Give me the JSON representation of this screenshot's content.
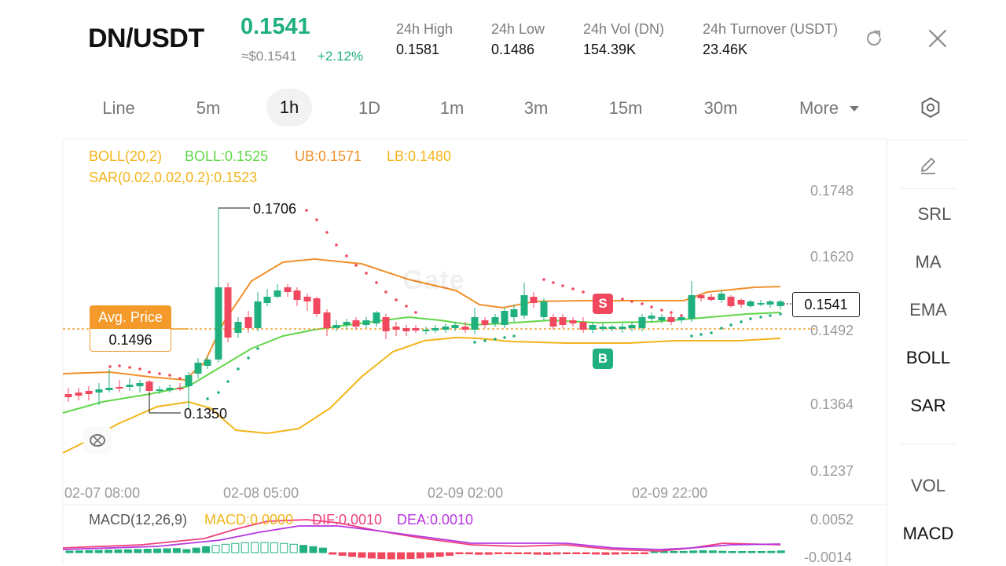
{
  "header": {
    "pair": "DN/USDT",
    "last_price": "0.1541",
    "approx_price": "≈$0.1541",
    "change_pct": "+2.12%",
    "stats": [
      {
        "label": "24h  High",
        "value": "0.1581"
      },
      {
        "label": "24h  Low",
        "value": "0.1486"
      },
      {
        "label": "24h  Vol (DN)",
        "value": "154.39K"
      },
      {
        "label": "24h  Turnover (USDT)",
        "value": "23.46K"
      }
    ]
  },
  "intervals": {
    "items": [
      "Line",
      "5m",
      "1h",
      "1D",
      "1m",
      "3m",
      "15m",
      "30m"
    ],
    "active": "1h",
    "more_label": "More"
  },
  "side_panel": {
    "items": [
      "SRL",
      "MA",
      "EMA",
      "BOLL",
      "SAR",
      "VOL",
      "MACD"
    ],
    "active": [
      "BOLL",
      "SAR",
      "MACD"
    ]
  },
  "indicators": {
    "boll_params": "BOLL(20,2)",
    "boll_mid": "BOLL:0.1525",
    "boll_ub": "UB:0.1571",
    "boll_lb": "LB:0.1480",
    "sar": "SAR(0.02,0.02,0.2):0.1523"
  },
  "price_axis": [
    "0.1748",
    "0.1620",
    "0.1492",
    "0.1364",
    "0.1237"
  ],
  "time_axis": [
    "02-07 08:00",
    "02-08 05:00",
    "02-09 02:00",
    "02-09 22:00"
  ],
  "annotations": {
    "high_label": "0.1706",
    "low_label": "0.1350",
    "avg_title": "Avg. Price",
    "avg_value": "0.1496",
    "current_price": "0.1541",
    "sell_marker": "S",
    "buy_marker": "B",
    "watermark": "Gate"
  },
  "macd": {
    "params": "MACD(12,26,9)",
    "macd": "MACD:0.0000",
    "dif": "DIF:0.0010",
    "dea": "DEA:0.0010",
    "axis": [
      "0.0052",
      "-0.0014"
    ]
  },
  "colors": {
    "up": "#1fb07e",
    "down": "#f0485f",
    "boll_ub": "#f0902a",
    "boll_mid": "#62d64a",
    "boll_lb": "#f2b41a",
    "sar_down": "#f0485f",
    "sar_up": "#1fb07e",
    "macd_dif": "#ef3f7d",
    "macd_dea": "#b536e0"
  }
}
